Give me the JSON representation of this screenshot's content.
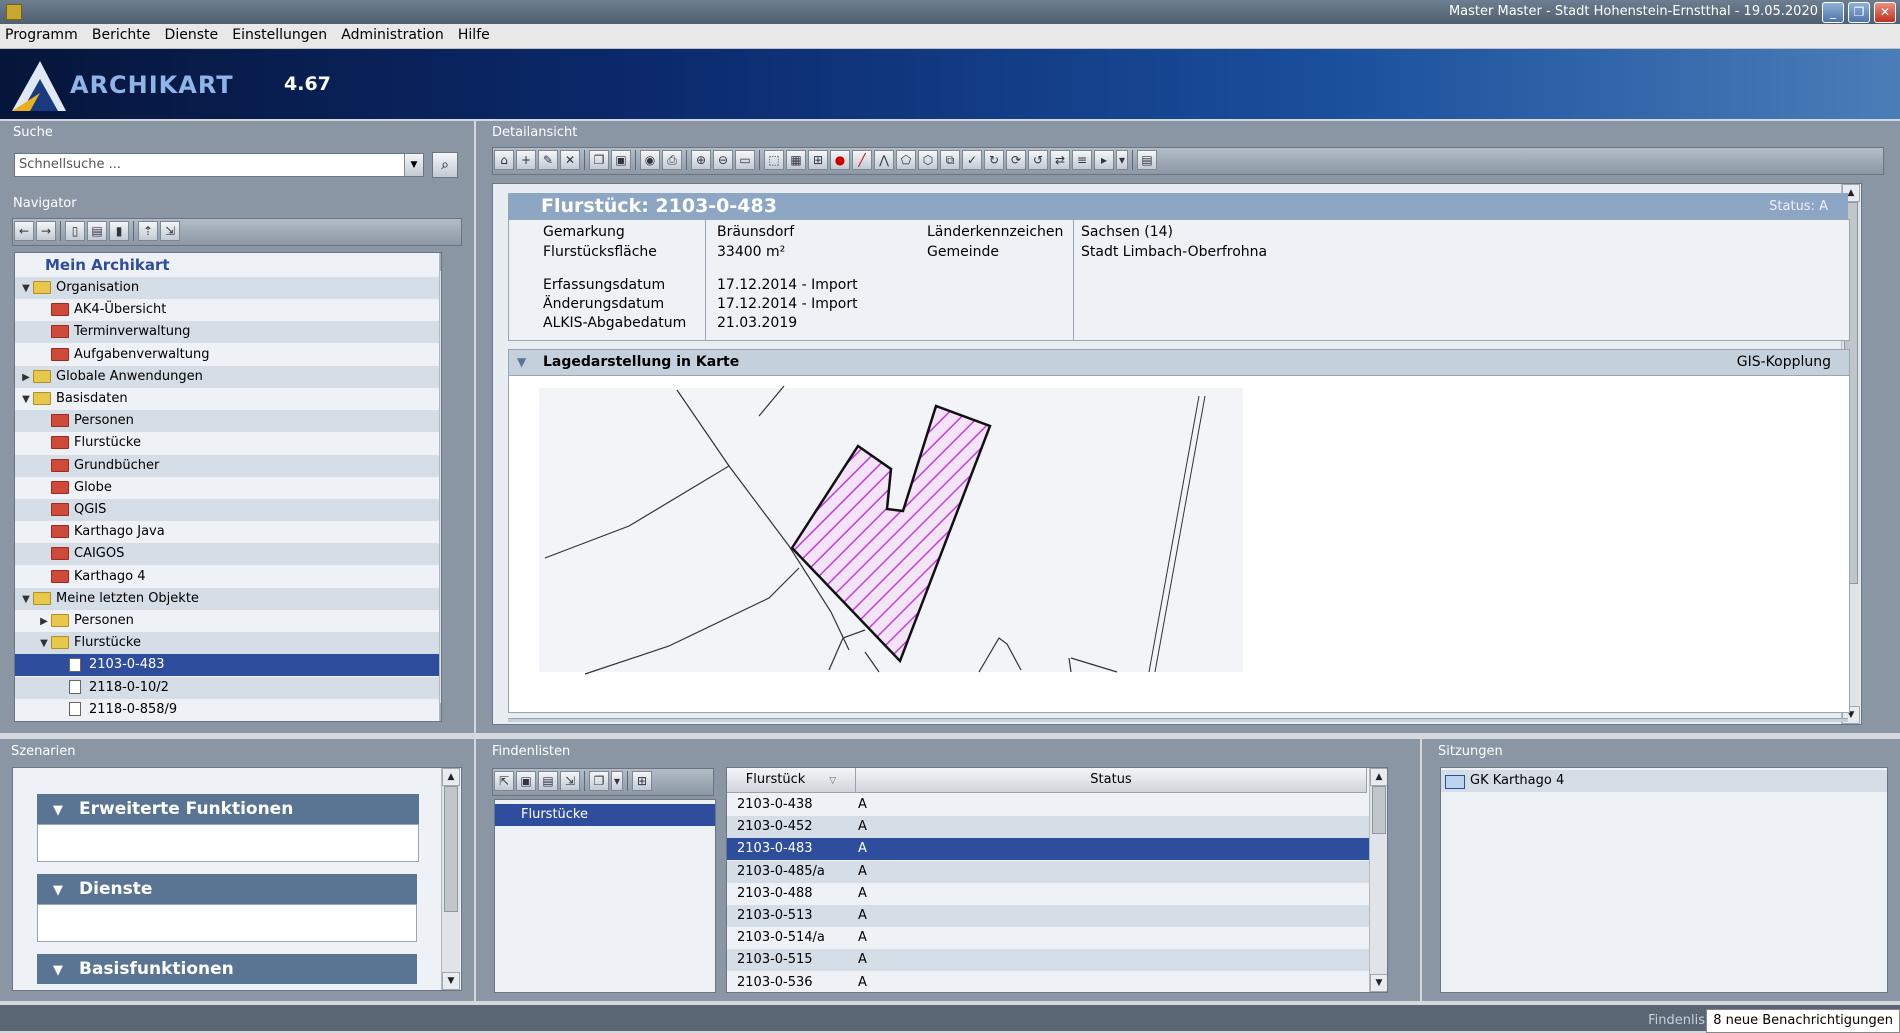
{
  "window": {
    "title": "Master Master - Stadt Hohenstein-Ernstthal - 19.05.2020"
  },
  "menu": [
    "Programm",
    "Berichte",
    "Dienste",
    "Einstellungen",
    "Administration",
    "Hilfe"
  ],
  "banner": {
    "logo": "ARCHIKART",
    "version": "4.67"
  },
  "suche": {
    "title": "Suche",
    "placeholder": "Schnellsuche ..."
  },
  "navigator": {
    "title": "Navigator",
    "root": "Mein Archikart",
    "items": [
      {
        "label": "Organisation",
        "level": 0,
        "expanded": true,
        "icon": "folder-yellow"
      },
      {
        "label": "AK4-Übersicht",
        "level": 1,
        "icon": "folder-red"
      },
      {
        "label": "Terminverwaltung",
        "level": 1,
        "icon": "folder-red"
      },
      {
        "label": "Aufgabenverwaltung",
        "level": 1,
        "icon": "folder-red"
      },
      {
        "label": "Globale Anwendungen",
        "level": 0,
        "expanded": false,
        "icon": "folder-yellow"
      },
      {
        "label": "Basisdaten",
        "level": 0,
        "expanded": true,
        "icon": "folder-yellow"
      },
      {
        "label": "Personen",
        "level": 1,
        "icon": "folder-red"
      },
      {
        "label": "Flurstücke",
        "level": 1,
        "icon": "folder-red"
      },
      {
        "label": "Grundbücher",
        "level": 1,
        "icon": "folder-red"
      },
      {
        "label": "Globe",
        "level": 1,
        "icon": "folder-red"
      },
      {
        "label": "QGIS",
        "level": 1,
        "icon": "folder-red"
      },
      {
        "label": "Karthago Java",
        "level": 1,
        "icon": "folder-red"
      },
      {
        "label": "CAIGOS",
        "level": 1,
        "icon": "folder-red"
      },
      {
        "label": "Karthago 4",
        "level": 1,
        "icon": "folder-red"
      },
      {
        "label": "Meine letzten Objekte",
        "level": 0,
        "expanded": true,
        "icon": "folder-yellow"
      },
      {
        "label": "Personen",
        "level": 1,
        "expanded": false,
        "icon": "folder-yellow"
      },
      {
        "label": "Flurstücke",
        "level": 1,
        "expanded": true,
        "icon": "folder-yellow"
      },
      {
        "label": "2103-0-483",
        "level": 2,
        "icon": "doc",
        "selected": true
      },
      {
        "label": "2118-0-10/2",
        "level": 2,
        "icon": "doc"
      },
      {
        "label": "2118-0-858/9",
        "level": 2,
        "icon": "doc"
      }
    ]
  },
  "detail": {
    "title": "Detailansicht",
    "flurstueck": {
      "heading": "Flurstück: 2103-0-483",
      "status": "Status: A",
      "fields": {
        "gemarkung_label": "Gemarkung",
        "gemarkung": "Bräunsdorf",
        "flaeche_label": "Flurstücksfläche",
        "flaeche": "33400 m²",
        "laender_label": "Länderkennzeichen",
        "laender": "Sachsen (14)",
        "gemeinde_label": "Gemeinde",
        "gemeinde": "Stadt Limbach-Oberfrohna",
        "erfassung_label": "Erfassungsdatum",
        "erfassung": "17.12.2014 - Import",
        "aenderung_label": "Änderungsdatum",
        "aenderung": "17.12.2014 - Import",
        "alkis_label": "ALKIS-Abgabedatum",
        "alkis": "21.03.2019"
      }
    },
    "lage": {
      "title": "Lagedarstellung in Karte",
      "gis": "GIS-Kopplung"
    }
  },
  "szenarien": {
    "title": "Szenarien",
    "sections": [
      "Erweiterte Funktionen",
      "Dienste",
      "Basisfunktionen"
    ]
  },
  "findenlisten": {
    "title": "Findenlisten",
    "lists": [
      "Flurstücke"
    ],
    "columns": [
      "Flurstück",
      "Status"
    ],
    "rows": [
      {
        "flurstueck": "2103-0-438",
        "status": "A"
      },
      {
        "flurstueck": "2103-0-452",
        "status": "A"
      },
      {
        "flurstueck": "2103-0-483",
        "status": "A",
        "selected": true
      },
      {
        "flurstueck": "2103-0-485/a",
        "status": "A"
      },
      {
        "flurstueck": "2103-0-488",
        "status": "A"
      },
      {
        "flurstueck": "2103-0-513",
        "status": "A"
      },
      {
        "flurstueck": "2103-0-514/a",
        "status": "A"
      },
      {
        "flurstueck": "2103-0-515",
        "status": "A"
      },
      {
        "flurstueck": "2103-0-536",
        "status": "A"
      }
    ]
  },
  "sitzungen": {
    "title": "Sitzungen",
    "items": [
      "GK Karthago 4"
    ]
  },
  "statusbar": {
    "left": "Findenlis",
    "notification": "8 neue Benachrichtigungen"
  }
}
